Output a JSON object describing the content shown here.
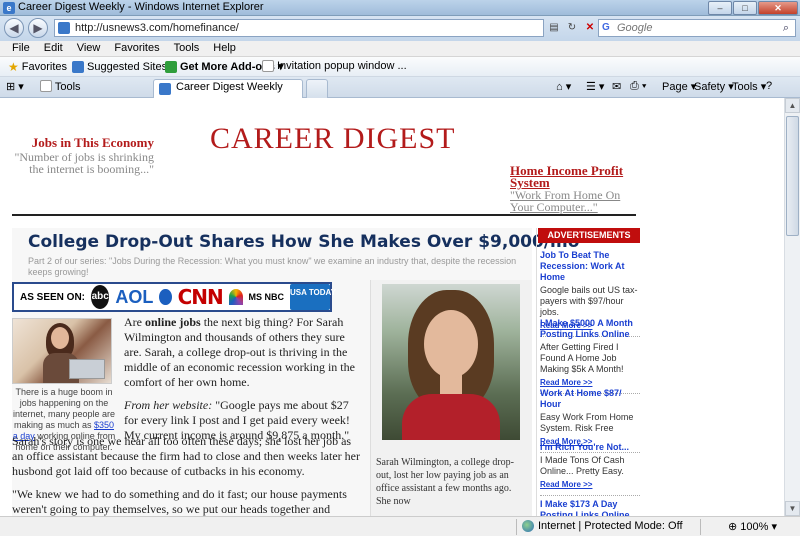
{
  "window": {
    "title": "Career Digest Weekly - Windows Internet Explorer",
    "controls": [
      "–",
      "□",
      "✕"
    ]
  },
  "address": {
    "url": "http://usnews3.com/homefinance/",
    "search_placeholder": "Google"
  },
  "menu": [
    "File",
    "Edit",
    "View",
    "Favorites",
    "Tools",
    "Help"
  ],
  "favorites_bar": {
    "favorites": "Favorites",
    "suggested": "Suggested Sites ▾",
    "addons": "Get More Add-ons ▾",
    "invitation": "Invitation popup window ..."
  },
  "tabs": {
    "tools_tab": "Tools",
    "active_tab": "Career Digest Weekly"
  },
  "command_bar": {
    "page": "Page ▾",
    "safety": "Safety ▾",
    "tools": "Tools ▾",
    "help": "?"
  },
  "status": {
    "zone": "Internet | Protected Mode: Off",
    "zoom": "100%"
  },
  "page": {
    "masthead": "CAREER DIGEST",
    "left_teaser": {
      "heading": "Jobs in This Economy",
      "sub": "\"Number of jobs is shrinking the internet is booming...\""
    },
    "right_teaser": {
      "heading": "Home Income Profit System",
      "sub": "\"Work From Home On Your Computer...\""
    },
    "headline": "College Drop-Out Shares How She Makes Over $9,000/mo",
    "subline": "Part 2 of our series: \"Jobs During the Recession: What you must know\" we examine an industry that, despite the recession keeps growing!",
    "as_seen_on": {
      "label": "AS SEEN ON:",
      "abc": "abc",
      "aol": "AOL",
      "cnn": "CNN",
      "msnbc": "MS NBC",
      "usatoday": "USA TODAY"
    },
    "small_caption_pre": "There is a huge boom in jobs happening on the internet, many people are making as much as ",
    "small_caption_link": "$350 a day",
    "small_caption_post": " working online from home on their computer.",
    "p1_pre": "Are ",
    "p1_bold": "online jobs",
    "p1_post": " the next big thing? For Sarah Wilmington and thousands of others they sure are. Sarah, a college drop-out is thriving in the middle of an economic recession working in the comfort of her own home.",
    "p2_italic": "From her website:",
    "p2_rest": " \"Google pays me about $27 for every link I post and I get paid every week! My current income is around $9,875 a month.\"",
    "p3": "Sarah's story is one we hear all too often these days; she lost her job as an office assistant because the firm had to close and then weeks later her husbond got laid off too because of cutbacks in his economy.",
    "p4": "\"We knew we had to do something and do it fast; our house payments weren't going to pay themselves, so we put our heads together and started",
    "photo_caption": "Sarah Wilmington, a college drop-out, lost her low paying job as an office assistant a few months ago. She now"
  },
  "ads": {
    "header": "ADVERTISEMENTS",
    "items": [
      {
        "title": "Job To Beat The Recession: Work At Home",
        "body": "Google bails out US tax-payers with $97/hour jobs.",
        "more": "Read More >>"
      },
      {
        "title": "I Make $5000 A Month Posting Links Online",
        "body": "After Getting Fired I Found A Home Job Making $5k A Month!",
        "more": "Read More >>"
      },
      {
        "title": "Work At Home $87/ Hour",
        "body": "Easy Work From Home System. Risk Free",
        "more": "Read More >>"
      },
      {
        "title": "I'm Rich You're Not...",
        "body": "I Made Tons Of Cash Online... Pretty Easy.",
        "more": "Read More >>"
      },
      {
        "title": "I Make $173 A Day Posting Links Online",
        "body": "",
        "more": ""
      }
    ]
  }
}
